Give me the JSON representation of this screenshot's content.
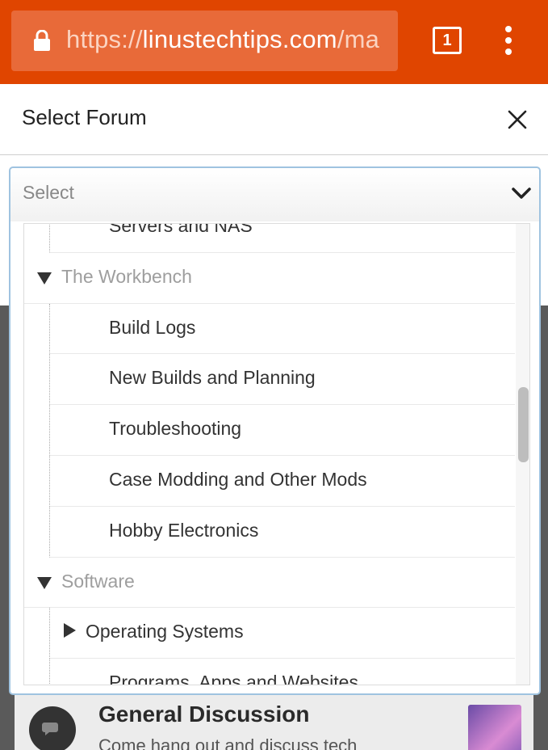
{
  "browser": {
    "url_scheme": "https://",
    "url_host": "linustechtips.com",
    "url_path": "/ma",
    "tab_count": "1",
    "icons": [
      "lock-icon",
      "tabs-icon",
      "menu-kebab-icon"
    ]
  },
  "modal": {
    "title": "Select Forum",
    "close_icon": "close-icon"
  },
  "select": {
    "value": "Select",
    "icon": "chevron-down-icon"
  },
  "dropdown": {
    "items": [
      {
        "type": "child",
        "label": "Servers and NAS"
      },
      {
        "type": "group",
        "label": "The Workbench"
      },
      {
        "type": "child",
        "label": "Build Logs"
      },
      {
        "type": "child",
        "label": "New Builds and Planning"
      },
      {
        "type": "child",
        "label": "Troubleshooting"
      },
      {
        "type": "child",
        "label": "Case Modding and Other Mods"
      },
      {
        "type": "child",
        "label": "Hobby Electronics"
      },
      {
        "type": "group",
        "label": "Software"
      },
      {
        "type": "collapsed",
        "label": "Operating Systems"
      },
      {
        "type": "child",
        "label": "Programs, Apps and Websites"
      }
    ]
  },
  "background_page": {
    "forum_title": "General Discussion",
    "forum_description": "Come hang out and discuss tech"
  },
  "colors": {
    "browser_bar": "#e04500",
    "select_border": "#9fc3e0",
    "group_text": "#9e9e9e"
  }
}
